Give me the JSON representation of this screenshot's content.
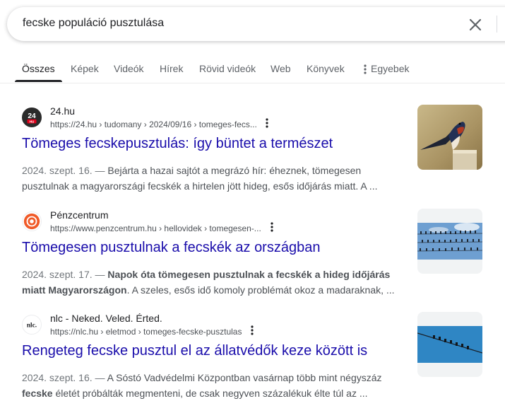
{
  "search": {
    "query": "fecske populáció pusztulása"
  },
  "tabs": [
    {
      "label": "Összes"
    },
    {
      "label": "Képek"
    },
    {
      "label": "Videók"
    },
    {
      "label": "Hírek"
    },
    {
      "label": "Rövid videók"
    },
    {
      "label": "Web"
    },
    {
      "label": "Könyvek"
    },
    {
      "label": "Egyebek"
    }
  ],
  "results": [
    {
      "site": "24.hu",
      "favicon_text": "24",
      "favicon_sub": "HU",
      "url": "https://24.hu › tudomany › 2024/09/16 › tomeges-fecs...",
      "title": "Tömeges fecskepusztulás: így büntet a természet",
      "date": "2024. szept. 16. —",
      "snippet_line1": " Bejárta a hazai sajtót a megrázó hír: éheznek, tömegesen",
      "snippet_line2": "pusztulnak a magyarországi fecskék a hirtelen jött hideg, esős időjárás miatt. A ..."
    },
    {
      "site": "Pénzcentrum",
      "url": "https://www.penzcentrum.hu › hellovidek › tomegesen-...",
      "title": "Tömegesen pusztulnak a fecskék az országban",
      "date": "2024. szept. 17. —",
      "snippet_bold1": " Napok óta tömegesen pusztulnak a fecskék a hideg időjárás",
      "snippet_bold2": "miatt Magyarországon",
      "snippet_rest2": ". A szeles, esős idő komoly problémát okoz a madaraknak, ..."
    },
    {
      "site": "nlc - Neked. Veled. Érted.",
      "favicon_text": "nlc.",
      "url": "https://nlc.hu › eletmod › tomeges-fecske-pusztulas",
      "title": "Rengeteg fecske pusztul el az állatvédők keze között is",
      "date": "2024. szept. 16. —",
      "snippet_line1": " A Sóstó Vadvédelmi Központban vasárnap több mint négyszáz",
      "snippet_bold2": "fecske",
      "snippet_rest2": " életét próbálták megmenteni, de csak negyven százalékuk élte túl az ..."
    }
  ],
  "colors": {
    "link": "#1a0dab",
    "text": "#202124",
    "muted": "#4d5156",
    "favicon_24hu": "#2b2b2b",
    "favicon_24hu_accent": "#e2001a",
    "favicon_penzcentrum": "#f05a28"
  }
}
